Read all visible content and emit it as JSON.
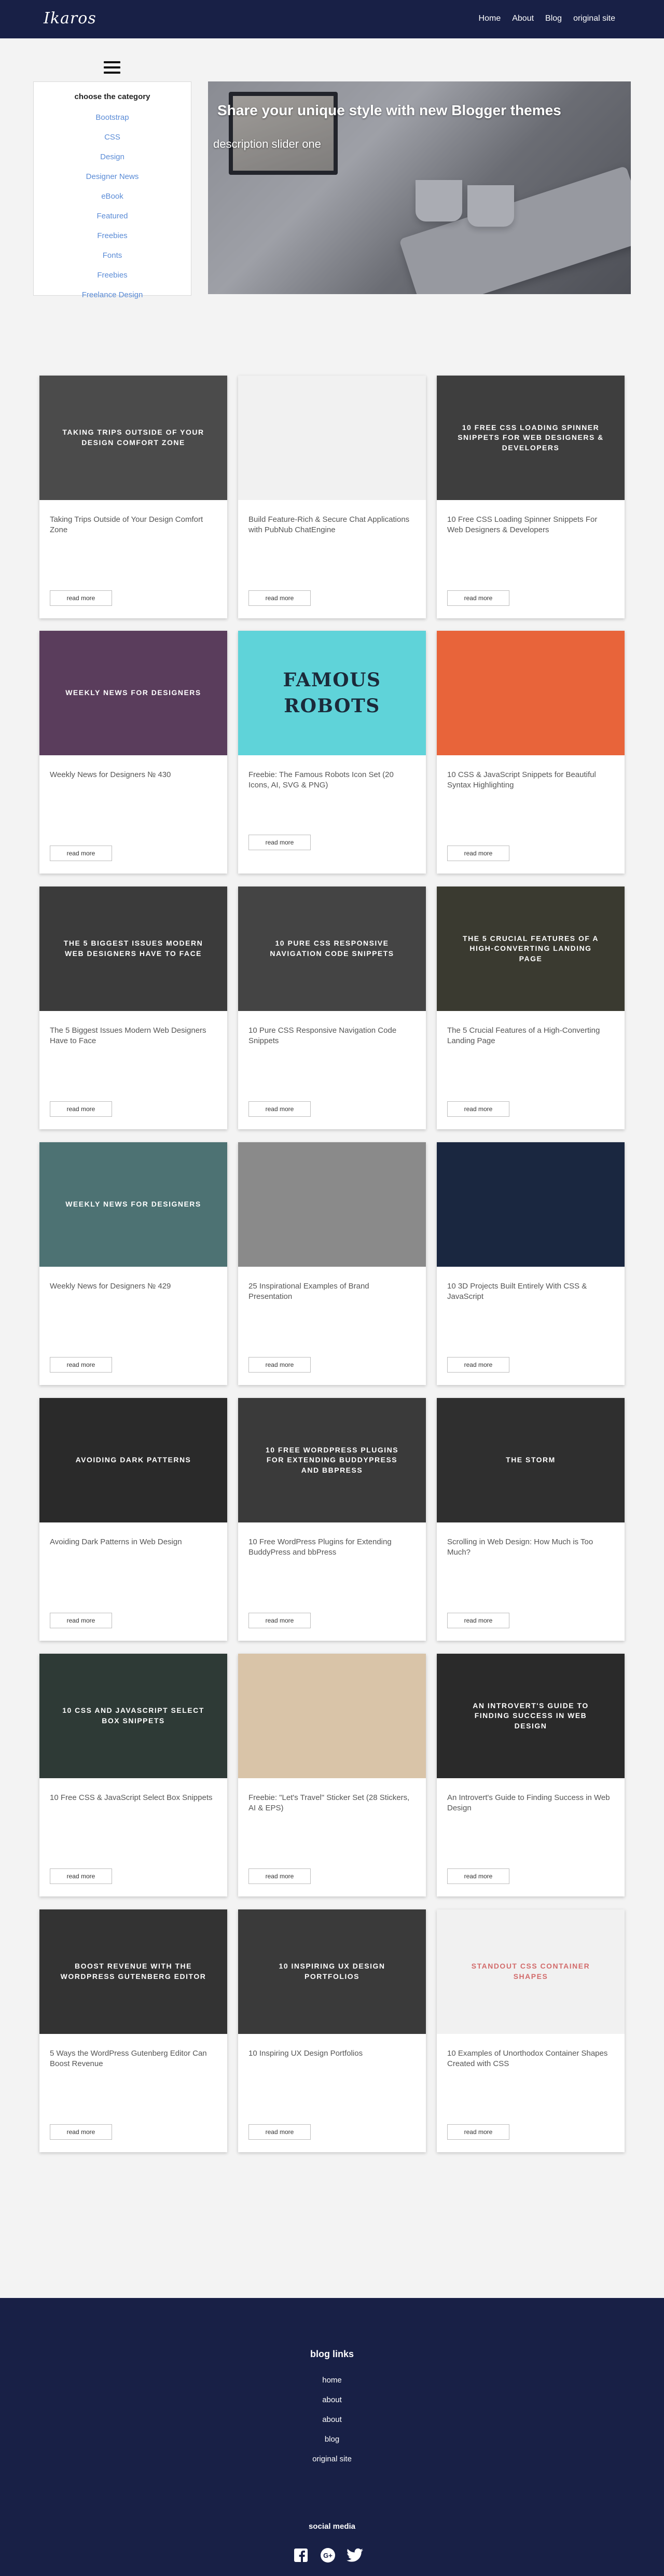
{
  "header": {
    "logo": "Ikaros",
    "nav": [
      "Home",
      "About",
      "Blog",
      "original site"
    ]
  },
  "categories": {
    "title": "choose the category",
    "items": [
      "Bootstrap",
      "CSS",
      "Design",
      "Designer News",
      "eBook",
      "Featured",
      "Freebies",
      "Fonts",
      "Freebies",
      "Freelance Design"
    ]
  },
  "slider": {
    "title": "Share your unique style with new Blogger themes",
    "description": "description slider one",
    "slide_count": 5,
    "active_slide": 1
  },
  "read_more_label": "read more",
  "cards": [
    {
      "title": "Taking Trips Outside of Your Design Comfort Zone",
      "thumb_text": "Taking trips outside of your design comfort zone",
      "bg": "#4b4b4b"
    },
    {
      "title": "Build Feature-Rich & Secure Chat Applications with PubNub ChatEngine",
      "thumb_text": "",
      "bg": "#f1f1f1"
    },
    {
      "title": "10 Free CSS Loading Spinner Snippets For Web Designers & Developers",
      "thumb_text": "10 free CSS loading spinner snippets for web designers & developers",
      "bg": "#3e3e3e"
    },
    {
      "title": "Weekly News for Designers № 430",
      "thumb_text": "Weekly News for Designers",
      "bg": "#5a3d5c"
    },
    {
      "title": "Freebie: The Famous Robots Icon Set (20 Icons, AI, SVG & PNG)",
      "thumb_text": "FAMOUS ROBOTS",
      "bg": "#5fd3d9"
    },
    {
      "title": "10 CSS & JavaScript Snippets for Beautiful Syntax Highlighting",
      "thumb_text": "",
      "bg": "#e8643a"
    },
    {
      "title": "The 5 Biggest Issues Modern Web Designers Have to Face",
      "thumb_text": "The 5 biggest issues modern web designers have to face",
      "bg": "#3b3b3b"
    },
    {
      "title": "10 Pure CSS Responsive Navigation Code Snippets",
      "thumb_text": "10 pure CSS responsive navigation code snippets",
      "bg": "#444444"
    },
    {
      "title": "The 5 Crucial Features of a High-Converting Landing Page",
      "thumb_text": "The 5 crucial features of a high-converting landing page",
      "bg": "#3a3a30"
    },
    {
      "title": "Weekly News for Designers № 429",
      "thumb_text": "Weekly News for Designers",
      "bg": "#4d7273"
    },
    {
      "title": "25 Inspirational Examples of Brand Presentation",
      "thumb_text": "",
      "bg": "#8a8a8a"
    },
    {
      "title": "10 3D Projects Built Entirely With CSS & JavaScript",
      "thumb_text": "",
      "bg": "#1a2740"
    },
    {
      "title": "Avoiding Dark Patterns in Web Design",
      "thumb_text": "Avoiding dark patterns",
      "bg": "#2a2a2a"
    },
    {
      "title": "10 Free WordPress Plugins for Extending BuddyPress and bbPress",
      "thumb_text": "10 free WordPress plugins for extending BuddyPress and bbPress",
      "bg": "#3a3a3a"
    },
    {
      "title": "Scrolling in Web Design: How Much is Too Much?",
      "thumb_text": "THE STORM",
      "bg": "#2f2f2f"
    },
    {
      "title": "10 Free CSS & JavaScript Select Box Snippets",
      "thumb_text": "10 CSS and JavaScript select box snippets",
      "bg": "#2e3a36"
    },
    {
      "title": "Freebie: \"Let's Travel\" Sticker Set (28 Stickers, AI & EPS)",
      "thumb_text": "",
      "bg": "#d9c4a8"
    },
    {
      "title": "An Introvert's Guide to Finding Success in Web Design",
      "thumb_text": "An introvert's guide to finding success in web design",
      "bg": "#2a2a2a"
    },
    {
      "title": "5 Ways the WordPress Gutenberg Editor Can Boost Revenue",
      "thumb_text": "Boost revenue with the WordPress Gutenberg editor",
      "bg": "#333333"
    },
    {
      "title": "10 Inspiring UX Design Portfolios",
      "thumb_text": "10 inspiring UX design portfolios",
      "bg": "#3a3a3a"
    },
    {
      "title": "10 Examples of Unorthodox Container Shapes Created with CSS",
      "thumb_text": "Standout CSS container shapes",
      "bg": "#f1f1f1"
    }
  ],
  "footer": {
    "blog_links_title": "blog links",
    "links": [
      "home",
      "about",
      "about",
      "blog",
      "original site"
    ],
    "social_title": "social media",
    "social": [
      "facebook-icon",
      "google-plus-icon",
      "twitter-icon"
    ]
  }
}
